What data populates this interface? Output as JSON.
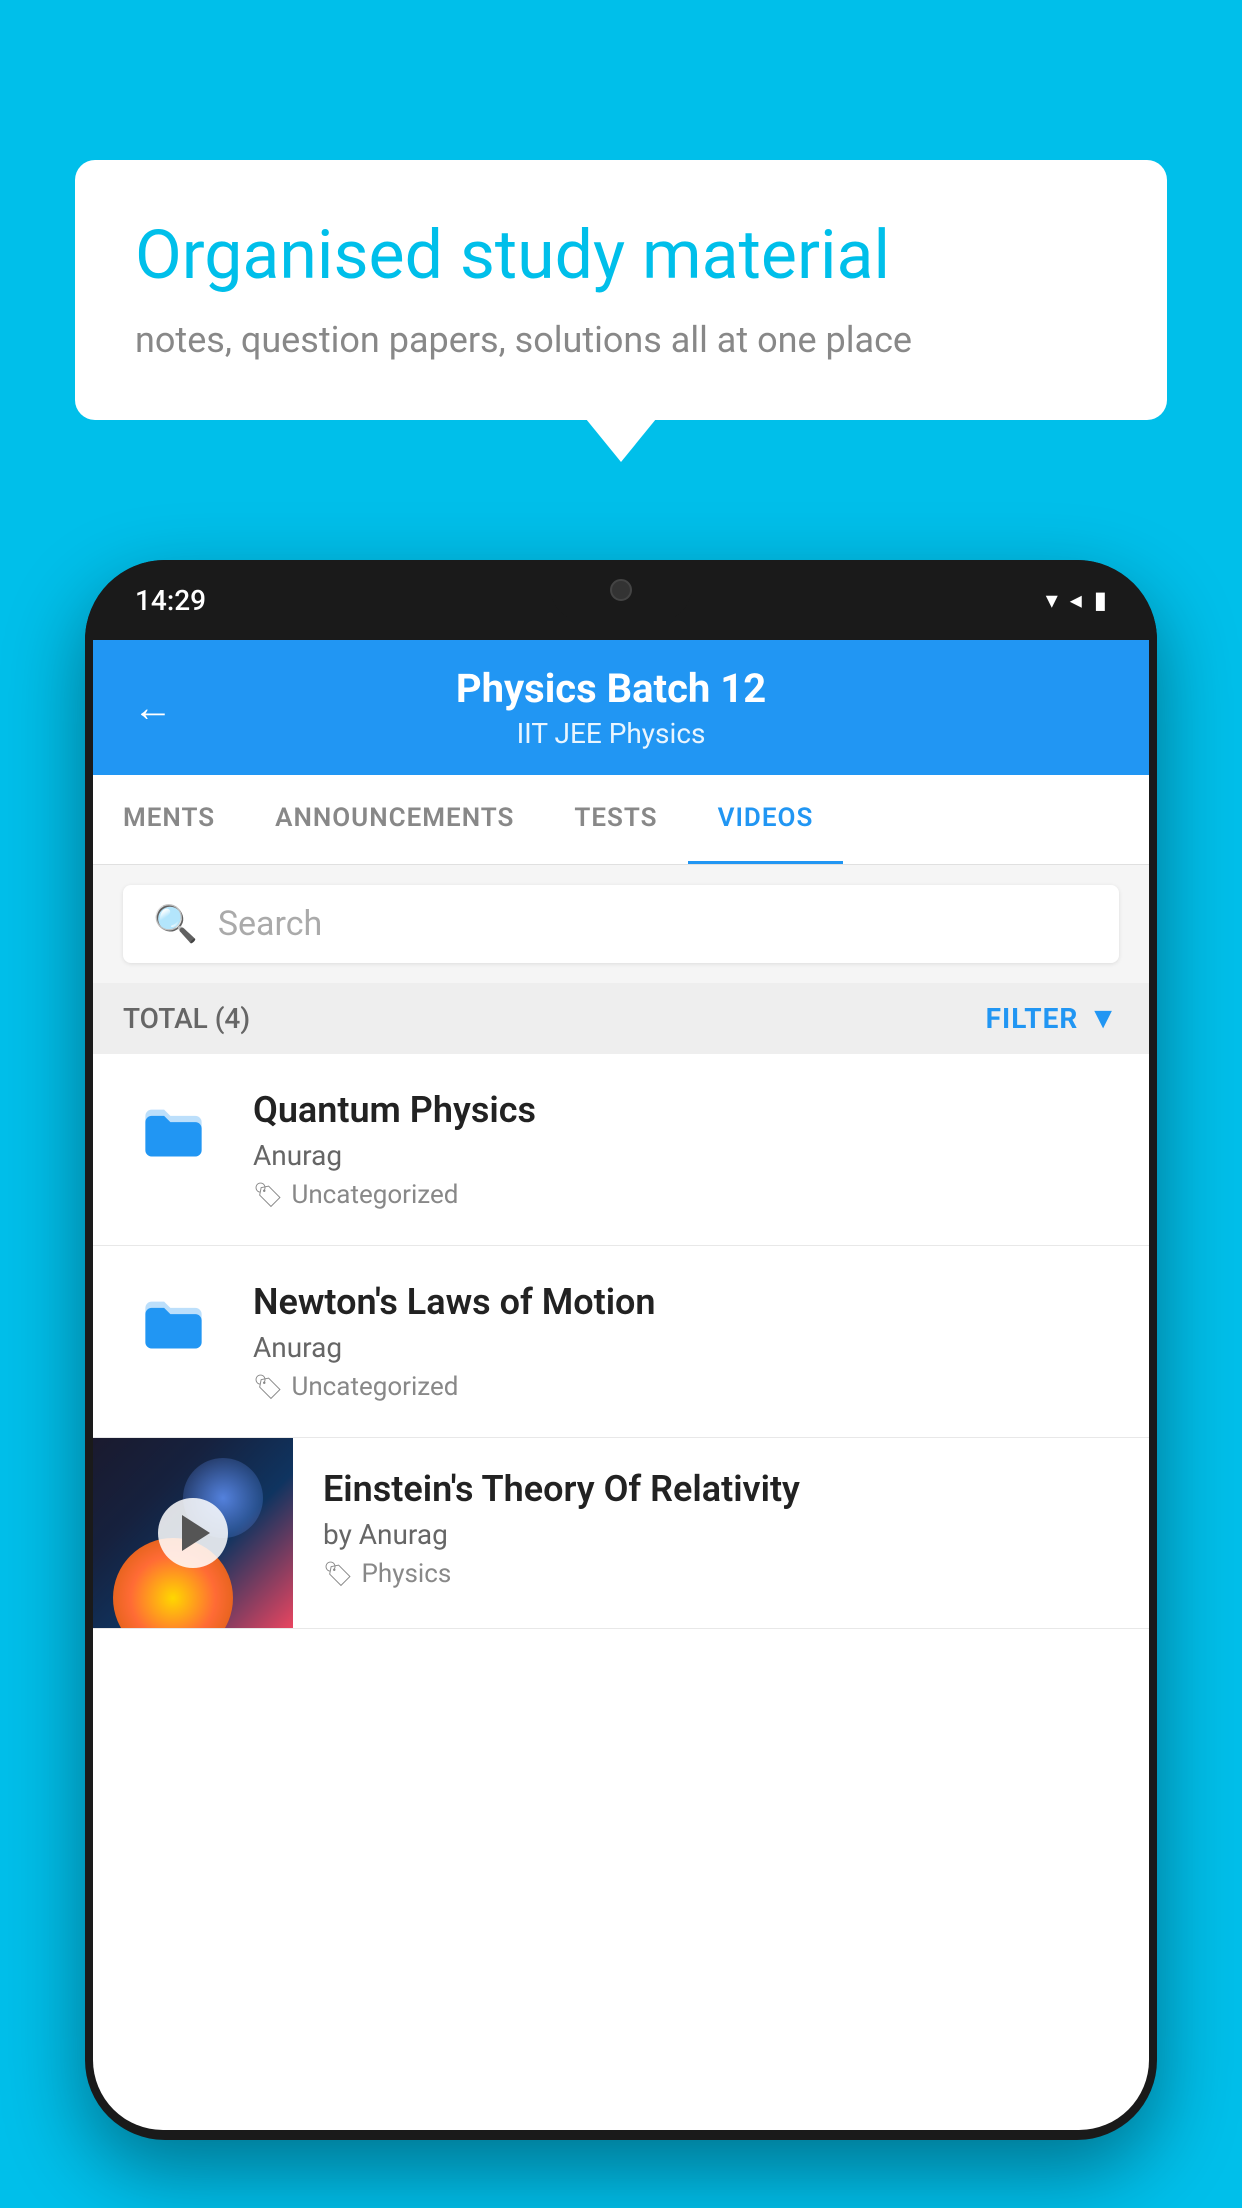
{
  "background_color": "#00BFEA",
  "speech_bubble": {
    "title": "Organised study material",
    "subtitle": "notes, question papers, solutions all at one place"
  },
  "phone": {
    "status_bar": {
      "time": "14:29",
      "icons": [
        "wifi",
        "signal",
        "battery"
      ]
    },
    "header": {
      "back_label": "←",
      "title": "Physics Batch 12",
      "tags": "IIT JEE   Physics"
    },
    "tabs": [
      {
        "label": "MENTS",
        "active": false
      },
      {
        "label": "ANNOUNCEMENTS",
        "active": false
      },
      {
        "label": "TESTS",
        "active": false
      },
      {
        "label": "VIDEOS",
        "active": true
      }
    ],
    "search": {
      "placeholder": "Search"
    },
    "filter_row": {
      "total": "TOTAL (4)",
      "filter_label": "FILTER"
    },
    "videos": [
      {
        "title": "Quantum Physics",
        "author": "Anurag",
        "tag": "Uncategorized",
        "has_thumb": false
      },
      {
        "title": "Newton's Laws of Motion",
        "author": "Anurag",
        "tag": "Uncategorized",
        "has_thumb": false
      },
      {
        "title": "Einstein's Theory Of Relativity",
        "author": "by Anurag",
        "tag": "Physics",
        "has_thumb": true
      }
    ]
  }
}
